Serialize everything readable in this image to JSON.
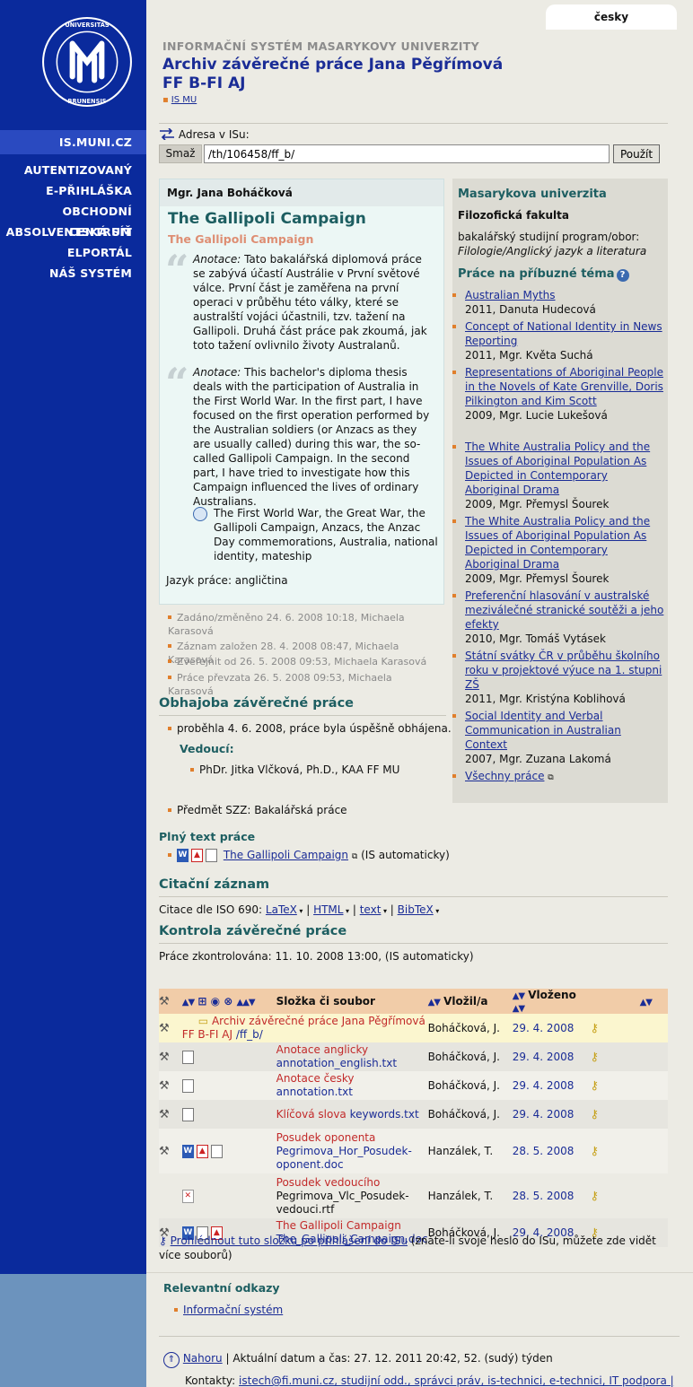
{
  "language": "česky",
  "nav": {
    "active": "IS.MUNI.CZ",
    "items": [
      "AUTENTIZOVANÝ",
      "E-PŘIHLÁŠKA",
      "OBCHODNÍ CENTRUM",
      "ABSOLVENTSKÁ SÍŤ",
      "ELPORTÁL",
      "NÁŠ SYSTÉM"
    ]
  },
  "header": {
    "system_name": "INFORMAČNÍ SYSTÉM MASARYKOVY UNIVERZITY",
    "title_line1": "Archiv závěrečné práce Jana Pěgřímová",
    "title_line2": "FF B-FI AJ",
    "breadcrumb": "IS MU"
  },
  "address": {
    "label": "Adresa v ISu:",
    "clear_button": "Smaž",
    "value": "/th/106458/ff_b/",
    "go_button": "Použít"
  },
  "detail": {
    "author": "Mgr. Jana Boháčková",
    "title": "The Gallipoli Campaign",
    "subtitle": "The Gallipoli Campaign",
    "anot_label": "Anotace:",
    "anot_cz": "Tato bakalářská diplomová práce se zabývá účastí Austrálie v První světové válce. První část je zaměřena na první operaci v průběhu této války, které se australští vojáci účastnili, tzv. tažení na Gallipoli. Druhá část práce pak zkoumá, jak toto tažení ovlivnilo životy Australanů.",
    "anot_en": "This bachelor's diploma thesis deals with the participation of Australia in the First World War. In the first part, I have focused on the first operation performed by the Australian soldiers (or Anzacs as they are usually called) during this war, the so-called Gallipoli Campaign. In the second part, I have tried to investigate how this Campaign influenced the lives of ordinary Australians.",
    "keywords": "The First World War, the Great War, the Gallipoli Campaign, Anzacs, the Anzac Day commemorations, Australia, national identity, mateship",
    "language": "Jazyk práce: angličtina"
  },
  "meta": [
    "Zadáno/změněno 24. 6. 2008 10:18, Michaela Karasová",
    "Záznam založen 28. 4. 2008 08:47, Michaela Karasová",
    "Zveřejnit od 26. 5. 2008 09:53, Michaela Karasová",
    "Práce převzata 26. 5. 2008 09:53, Michaela Karasová"
  ],
  "defense": {
    "title": "Obhajoba závěrečné práce",
    "result": "proběhla 4. 6. 2008, práce byla úspěšně obhájena.",
    "supervisor_label": "Vedoucí:",
    "supervisor": "PhDr. Jitka Vlčková, Ph.D., KAA FF MU",
    "subject": "Předmět SZZ: Bakalářská práce"
  },
  "fulltext": {
    "title": "Plný text práce",
    "link": "The Gallipoli Campaign",
    "note": "(IS automaticky)"
  },
  "citation": {
    "title": "Citační záznam",
    "label": "Citace dle ISO 690:",
    "formats": [
      "LaTeX",
      "HTML",
      "text",
      "BibTeX"
    ]
  },
  "check": {
    "title": "Kontrola závěrečné práce",
    "text": "Práce zkontrolována: 11. 10. 2008 13:00, (IS automaticky)"
  },
  "files": {
    "headers": {
      "name": "Složka či soubor",
      "by": "Vložil/a",
      "date": "Vloženo"
    },
    "rows": [
      {
        "label": "Archiv závěrečné práce Jana Pěgřímová FF B-FI AJ",
        "file": "/ff_b/",
        "by": "Boháčková, J.",
        "date": "29. 4. 2008"
      },
      {
        "label": "Anotace anglicky",
        "file": "annotation_english.txt",
        "by": "Boháčková, J.",
        "date": "29. 4. 2008"
      },
      {
        "label": "Anotace česky",
        "file": "annotation.txt",
        "by": "Boháčková, J.",
        "date": "29. 4. 2008"
      },
      {
        "label": "Klíčová slova",
        "file": "keywords.txt",
        "by": "Boháčková, J.",
        "date": "29. 4. 2008"
      },
      {
        "label": "Posudek oponenta",
        "file": "Pegrimova_Hor_Posudek-oponent.doc",
        "by": "Hanzálek, T.",
        "date": "28. 5. 2008"
      },
      {
        "label": "Posudek vedoucího",
        "file": "Pegrimova_Vlc_Posudek-vedouci.rtf",
        "by": "Hanzálek, T.",
        "date": "28. 5. 2008"
      },
      {
        "label": "The Gallipoli Campaign",
        "file": "The_Gallipoli_Campaign.doc",
        "by": "Boháčková, J.",
        "date": "29. 4. 2008"
      }
    ],
    "login_link": "Prohlédnout tuto složku po přihlášení do ISu",
    "login_note": "(znáte-li svoje heslo do ISu, můžete zde vidět více souborů)"
  },
  "right": {
    "institution": "Masarykova univerzita",
    "faculty": "Filozofická fakulta",
    "program_label": "bakalářský studijní program/obor:",
    "program": "Filologie/Anglický jazyk a literatura",
    "related_title": "Práce na příbuzné téma",
    "related": [
      {
        "title": "Australian Myths",
        "meta": "2011, Danuta Hudecová"
      },
      {
        "title": "Concept of National Identity in News Reporting",
        "meta": "2011, Mgr. Květa Suchá"
      },
      {
        "title": "Representations of Aboriginal People in the Novels of Kate Grenville, Doris Pilkington and Kim Scott",
        "meta": "2009, Mgr. Lucie Lukešová"
      },
      {
        "title": "The White Australia Policy and the Issues of Aboriginal Population As Depicted in Contemporary Aboriginal Drama",
        "meta": "2009, Mgr. Přemysl Šourek"
      },
      {
        "title": "The White Australia Policy and the Issues of Aboriginal Population As Depicted in Contemporary Aboriginal Drama",
        "meta": "2009, Mgr. Přemysl Šourek"
      },
      {
        "title": "Preferenční hlasování v australské meziválečné stranické soutěži a jeho efekty",
        "meta": "2010, Mgr. Tomáš Vytásek"
      },
      {
        "title": "Státní svátky ČR v průběhu školního roku v projektové výuce na 1. stupni ZŠ",
        "meta": "2011, Mgr. Kristýna Koblihová"
      },
      {
        "title": "Social Identity and Verbal Communication in Australian Context",
        "meta": "2007, Mgr. Zuzana Lakomá"
      }
    ],
    "all_works": "Všechny práce"
  },
  "links": {
    "title": "Relevantní odkazy",
    "items": [
      "Informační systém"
    ]
  },
  "footer": {
    "top_link": "Nahoru",
    "datetime": "| Aktuální datum a čas: 27. 12. 2011 20:42, 52. (sudý) týden",
    "contacts_label": "Kontakty:",
    "contacts": "istech@fi.muni.cz, studijní odd., správci práv, is-technici, e-technici, IT podpora |"
  }
}
